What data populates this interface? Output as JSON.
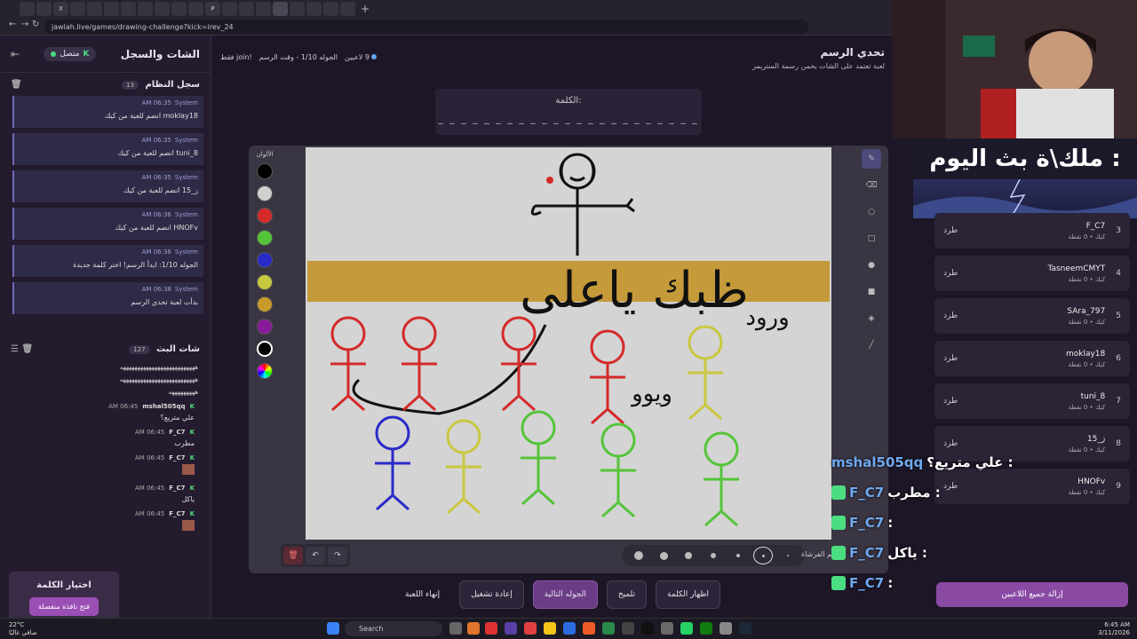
{
  "browser": {
    "url": "jawlah.live/games/drawing-challenge?kick=irev_24",
    "tabs": [
      "",
      "",
      "X",
      "",
      "",
      "",
      "",
      "",
      "",
      "",
      "",
      "P",
      "",
      "",
      "",
      "",
      "",
      "",
      "",
      ""
    ]
  },
  "left_panel": {
    "title": "الشات والسجل",
    "status": "متصل",
    "system_log": {
      "title": "سجل النظام",
      "count": "13",
      "items": [
        {
          "sender": "System",
          "time": "06:35 AM",
          "text": "moklay18 انضم للعبة من كيك"
        },
        {
          "sender": "System",
          "time": "06:35 AM",
          "text": "tuni_8 انضم للعبة من كيك"
        },
        {
          "sender": "System",
          "time": "06:35 AM",
          "text": "ز_15 انضم للعبة من كيك"
        },
        {
          "sender": "System",
          "time": "06:36 AM",
          "text": "HNOFv انضم للعبة من كيك"
        },
        {
          "sender": "System",
          "time": "06:38 AM",
          "text": "الجوله 1/10: ابدأ الرسم! اختر كلمة جديدة"
        },
        {
          "sender": "System",
          "time": "06:38 AM",
          "text": "بدأت لعبة تحدي الرسم"
        }
      ]
    },
    "stream_chat": {
      "title": "شات البث",
      "count": "127",
      "lines": [
        "ههههههههههههههههههههههههههه",
        "ههههههههههههههههههههههههههه",
        "هههههههههه"
      ],
      "messages": [
        {
          "user": "mshal505qq",
          "time": "06:45 AM",
          "text": "علي متريع؟",
          "emote": false
        },
        {
          "user": "F_C7",
          "time": "06:45 AM",
          "text": "مطرب",
          "emote": false
        },
        {
          "user": "F_C7",
          "time": "06:45 AM",
          "text": "",
          "emote": true
        },
        {
          "user": "F_C7",
          "time": "06:45 AM",
          "text": "ياكل",
          "emote": false
        },
        {
          "user": "F_C7",
          "time": "06:45 AM",
          "text": "",
          "emote": true
        }
      ]
    },
    "word_choice": {
      "title": "اختيار الكلمة",
      "button": "فتح نافذة منفصلة"
    }
  },
  "game": {
    "title": "تحدي الرسم",
    "subtitle": "لعبة تعتمد على الشات يخمن رسمة الستريمر",
    "players_count": "9 لاعبين",
    "round_info": "الجوله 1/10 - وقت الرسم",
    "join_hint": "!join فقط",
    "word_label": "الكلمة:",
    "word_dashes": "_ _ _ _ _ _    _ _ _    _ _ _ _ _ _ _    _ _ _ _    _ _ _",
    "colors_label": "الألوان",
    "brush_label": "حجم الفرشاة:",
    "colors": [
      "#000000",
      "#d0d0d0",
      "#d42a2a",
      "#55c43a",
      "#2a2ac8",
      "#c8c840",
      "#c89a2a",
      "#8a1a9a",
      "#000000",
      "rainbow"
    ],
    "actions": [
      "اظهار الكلمة",
      "تلميح",
      "الجوله التالية",
      "إعادة تشغيل",
      "إنهاء اللعبة"
    ]
  },
  "players": [
    {
      "rank": "3",
      "name": "F_C7",
      "meta": "كيك • 0 نقطة",
      "kick": "طرد"
    },
    {
      "rank": "4",
      "name": "TasneemCMYT",
      "meta": "كيك • 0 نقطة",
      "kick": "طرد"
    },
    {
      "rank": "5",
      "name": "SAra_797",
      "meta": "كيك • 0 نقطة",
      "kick": "طرد"
    },
    {
      "rank": "6",
      "name": "moklay18",
      "meta": "كيك • 0 نقطة",
      "kick": "طرد"
    },
    {
      "rank": "7",
      "name": "tuni_8",
      "meta": "كيك • 0 نقطة",
      "kick": "طرد"
    },
    {
      "rank": "8",
      "name": "ز_15",
      "meta": "كيك • 0 نقطة",
      "kick": "طرد"
    },
    {
      "rank": "9",
      "name": "HNOFv",
      "meta": "كيك • 0 نقطة",
      "kick": "طرد"
    }
  ],
  "remove_all": "إزالة جميع اللاعبين",
  "overlay": {
    "title": "ملك\\ة بث اليوم :",
    "chat": [
      {
        "name": "mshal505qq",
        "text": "علي متريع؟ :",
        "badge": false
      },
      {
        "name": "F_C7",
        "text": "مطرب :",
        "badge": true
      },
      {
        "name": "F_C7",
        "text": ":",
        "badge": true
      },
      {
        "name": "F_C7",
        "text": "ياكل :",
        "badge": true
      },
      {
        "name": "F_C7",
        "text": ":",
        "badge": true
      }
    ]
  },
  "drawing_text": {
    "big": "ظبك ياعلى",
    "side1": "ورود",
    "side2": "ويوو"
  },
  "taskbar": {
    "weather_temp": "22°C",
    "weather_desc": "صافي غالبًا",
    "search": "Search",
    "time": "6:45 AM",
    "date": "3/11/2026"
  }
}
